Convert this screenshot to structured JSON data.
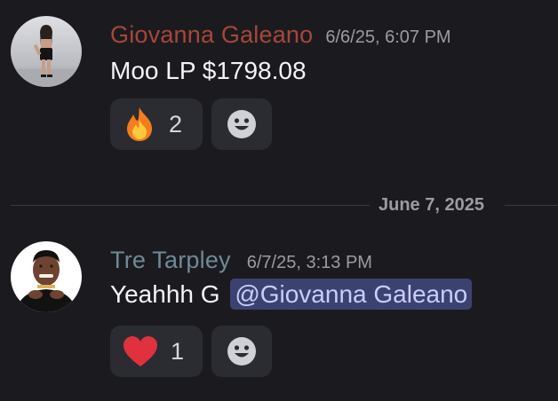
{
  "messages": [
    {
      "username": "Giovanna Galeano",
      "username_color": "#a4473a",
      "timestamp": "6/6/25, 6:07 PM",
      "text": "Moo LP $1798.08",
      "reactions": [
        {
          "emoji": "fire-icon",
          "count": "2"
        }
      ]
    },
    {
      "username": "Tre Tarpley",
      "username_color": "#6e8a96",
      "timestamp": "6/7/25, 3:13 PM",
      "text": "Yeahhh G",
      "mention": "@Giovanna Galeano",
      "reactions": [
        {
          "emoji": "heart-icon",
          "count": "1"
        }
      ]
    }
  ],
  "date_divider": "June 7, 2025",
  "colors": {
    "background": "#1b1b1f",
    "reaction_bg": "#2b2c31",
    "mention_bg": "#3c4270",
    "mention_text": "#c9cdfb"
  }
}
